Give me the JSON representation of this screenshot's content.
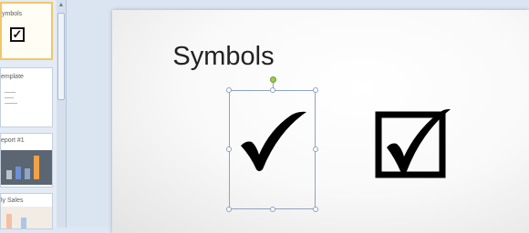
{
  "thumbnails": [
    {
      "index": 1,
      "title": "ymbols",
      "selected": true,
      "icon": "checkbox-icon"
    },
    {
      "index": 2,
      "title": "emplate",
      "selected": false
    },
    {
      "index": 3,
      "title": "eport #1",
      "selected": false
    },
    {
      "index": 4,
      "title": "ly Sales",
      "selected": false
    }
  ],
  "slide": {
    "title": "Symbols",
    "left_symbol": "check-mark",
    "right_symbol": "check-box"
  },
  "colors": {
    "selection_border": "#f2c66b",
    "handle_border": "#8ea3bf",
    "rotation_handle": "#9acd4a",
    "chart_blue": "#6f8fd6",
    "chart_orange": "#f0a24a"
  }
}
